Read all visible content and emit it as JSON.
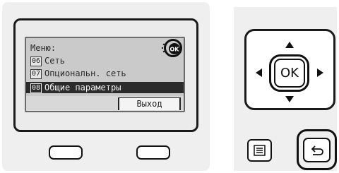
{
  "lcd": {
    "header": "Меню:",
    "items": [
      {
        "number": "06",
        "label": "Сеть"
      },
      {
        "number": "07",
        "label": "Опциональн. сеть"
      },
      {
        "number": "08",
        "label": "Общие параметры"
      }
    ],
    "selected_index": 2,
    "exit_label": "Выход",
    "ok_badge": "OK"
  },
  "dpad": {
    "ok_label": "OK"
  },
  "icons": {
    "menu": "list-menu-icon",
    "back": "back-arrow-icon",
    "up": "arrow-up-icon",
    "down": "arrow-down-icon",
    "left": "arrow-left-icon",
    "right": "arrow-right-icon"
  }
}
